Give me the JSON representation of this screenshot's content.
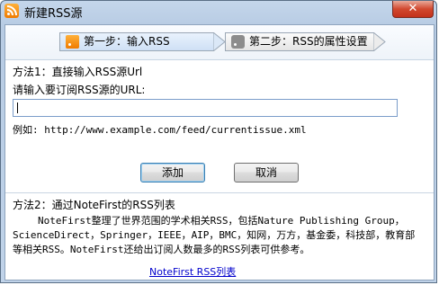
{
  "window": {
    "title": "新建RSS源",
    "close_label": "✕"
  },
  "steps": [
    {
      "label": "第一步：输入RSS"
    },
    {
      "label": "第二步：RSS的属性设置"
    }
  ],
  "method1": {
    "title": "方法1：直接输入RSS源Url",
    "prompt": "请输入要订阅RSS源的URL:",
    "input_value": "",
    "example": "例如: http://www.example.com/feed/currentissue.xml",
    "add_label": "添加",
    "cancel_label": "取消"
  },
  "method2": {
    "title": "方法2：通过NoteFirst的RSS列表",
    "description": "NoteFirst整理了世界范围的学术相关RSS，包括Nature Publishing Group，ScienceDirect，Springer，IEEE，AIP，BMC，知网，万方，基金委，科技部，教育部等相关RSS。NoteFirst还给出订阅人数最多的RSS列表可供参考。",
    "link_label": "NoteFirst RSS列表"
  }
}
